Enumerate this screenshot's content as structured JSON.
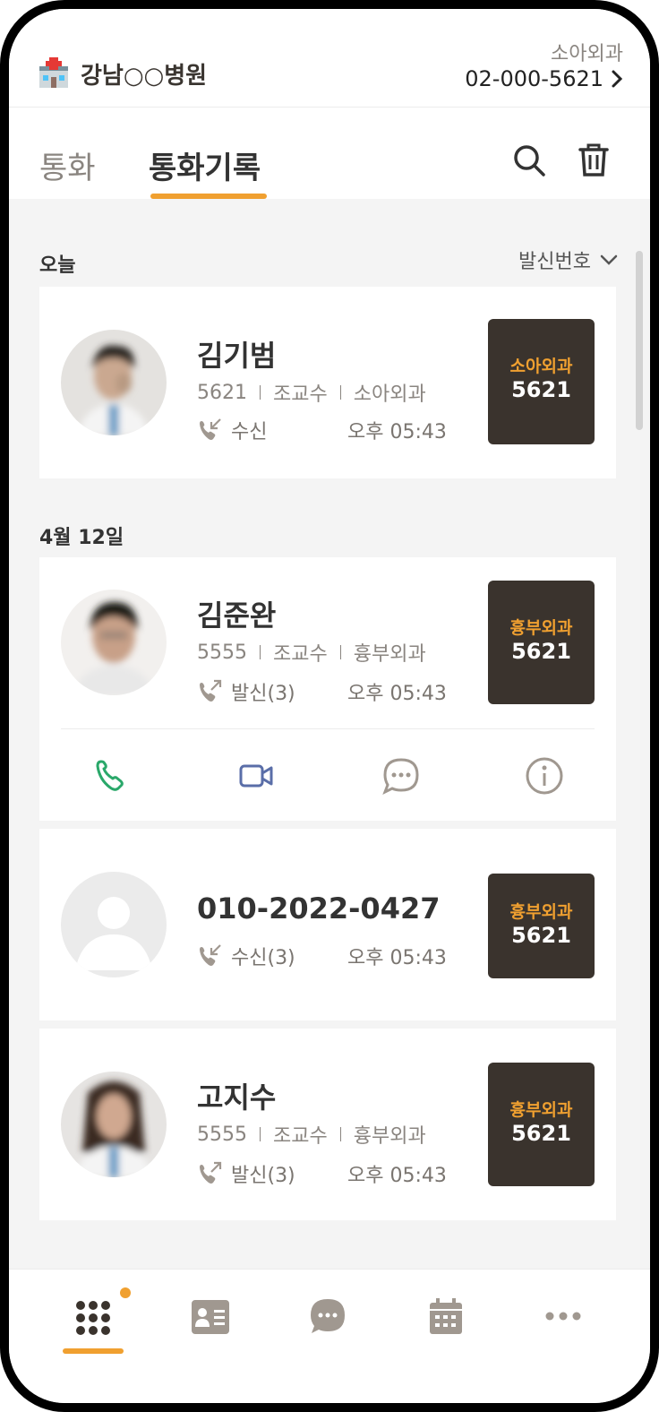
{
  "header": {
    "hospital_name": "강남○○병원",
    "department": "소아외과",
    "phone": "02-000-5621"
  },
  "tabs": [
    {
      "label": "통화",
      "active": false
    },
    {
      "label": "통화기록",
      "active": true
    }
  ],
  "filter": {
    "label": "발신번호"
  },
  "sections": [
    {
      "title": "오늘",
      "entries": [
        {
          "name": "김기범",
          "ext": "5621",
          "title": "조교수",
          "dept": "소아외과",
          "call_type": "수신",
          "time": "오후 05:43",
          "badge_dept": "소아외과",
          "badge_num": "5621",
          "call_icon": "incoming-call-icon"
        }
      ]
    },
    {
      "title": "4월 12일",
      "entries": [
        {
          "name": "김준완",
          "ext": "5555",
          "title": "조교수",
          "dept": "흉부외과",
          "call_type": "발신(3)",
          "time": "오후 05:43",
          "badge_dept": "흉부외과",
          "badge_num": "5621",
          "call_icon": "outgoing-call-icon"
        },
        {
          "name": "010-2022-0427",
          "call_type": "수신(3)",
          "time": "오후 05:43",
          "badge_dept": "흉부외과",
          "badge_num": "5621",
          "call_icon": "incoming-call-icon"
        },
        {
          "name": "고지수",
          "ext": "5555",
          "title": "조교수",
          "dept": "흉부외과",
          "call_type": "발신(3)",
          "time": "오후 05:43",
          "badge_dept": "흉부외과",
          "badge_num": "5621",
          "call_icon": "outgoing-call-icon"
        }
      ]
    }
  ],
  "actions": [
    "phone-icon",
    "video-call-icon",
    "chat-icon",
    "info-icon"
  ],
  "bottom_nav": [
    "dialpad-icon",
    "contacts-icon",
    "message-icon",
    "calendar-icon",
    "more-icon"
  ],
  "colors": {
    "accent": "#f0a030",
    "badge_bg": "#3a332d",
    "phone_green": "#2aa86a",
    "video_blue": "#5a6ea8"
  }
}
